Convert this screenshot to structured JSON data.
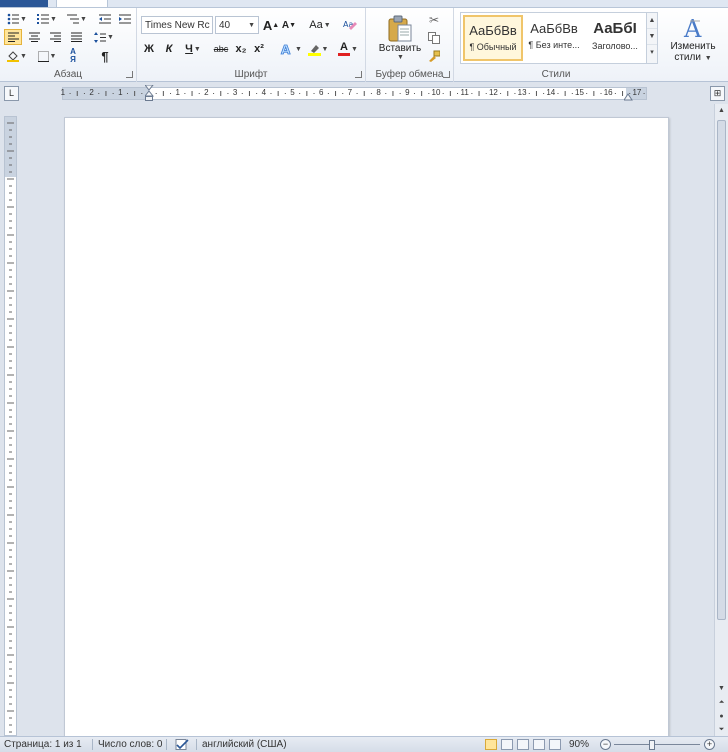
{
  "tabs": {
    "file": "",
    "home": "",
    "insert": "",
    "page_layout": "",
    "references": "",
    "mailings": "",
    "review": "",
    "view": ""
  },
  "ribbon": {
    "paragraph": {
      "label": "Абзац",
      "pilcrow": "¶"
    },
    "font": {
      "label": "Шрифт",
      "font_name": "Times New Rc",
      "font_size": "40",
      "grow_font": "A",
      "shrink_font": "A",
      "change_case": "Aa",
      "bold": "Ж",
      "italic": "К",
      "underline": "Ч",
      "strikethrough": "abc",
      "subscript": "x₂",
      "superscript": "x²",
      "font_color": "A"
    },
    "clipboard": {
      "label": "Буфер обмена",
      "paste_label": "Вставить"
    },
    "styles": {
      "label": "Стили",
      "items": [
        {
          "sample": "АаБбВв",
          "name": "¶ Обычный"
        },
        {
          "sample": "АаБбВв",
          "name": "¶ Без инте..."
        },
        {
          "sample": "АаБбI",
          "name": "Заголово..."
        }
      ],
      "change_styles_line1": "Изменить",
      "change_styles_line2": "стили"
    }
  },
  "ruler": {
    "numbers": [
      "1",
      "2",
      "1",
      "1",
      "2",
      "3",
      "4",
      "5",
      "6",
      "7",
      "8",
      "9",
      "10",
      "11",
      "12",
      "13",
      "14",
      "15",
      "16",
      "17"
    ]
  },
  "statusbar": {
    "page": "Страница: 1 из 1",
    "words": "Число слов: 0",
    "language": "английский (США)",
    "zoom": "90%",
    "zoom_minus": "−",
    "zoom_plus": "+"
  },
  "colors": {
    "accent_file_tab": "#2b5797",
    "selected_button": "#ffe59a",
    "font_color_bar": "#e02020",
    "highlight_bar": "#ffff00"
  }
}
